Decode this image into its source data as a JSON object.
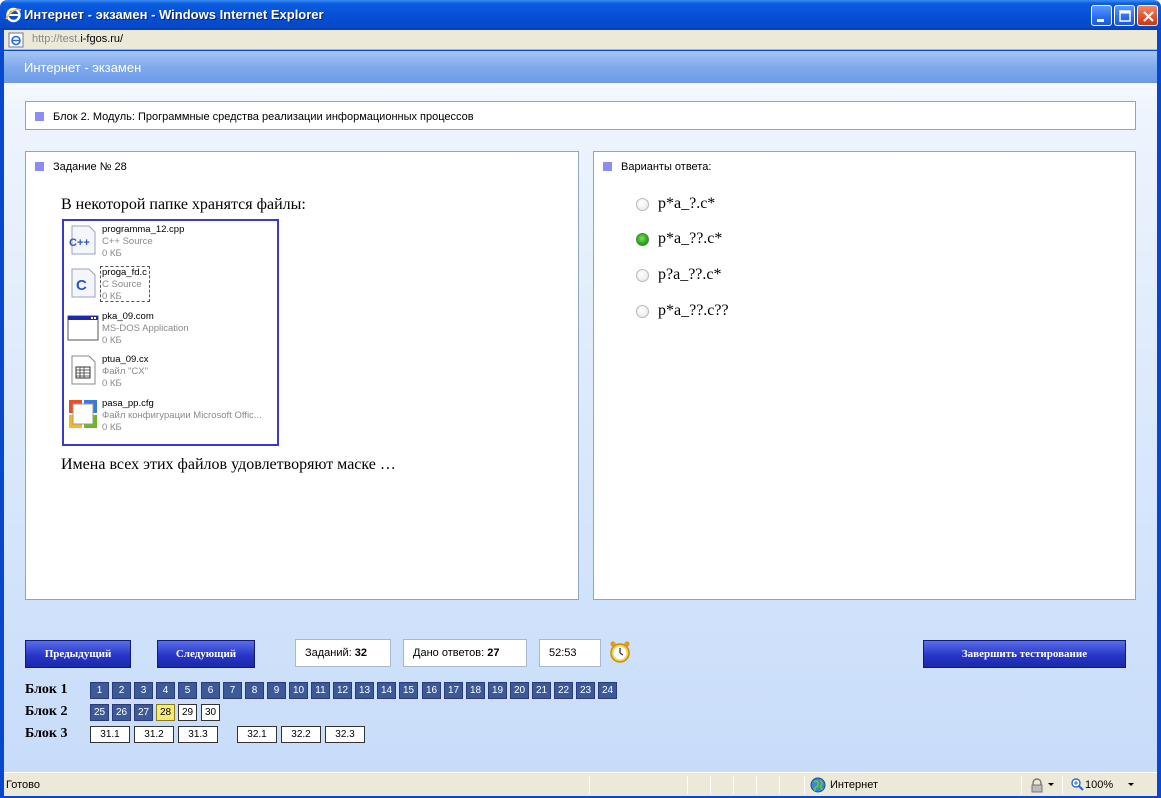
{
  "window": {
    "title": "Интернет - экзамен - Windows Internet Explorer",
    "address_prefix": "http://test.",
    "address_host": "i-fgos.ru/"
  },
  "app": {
    "header_title": "Интернет - экзамен",
    "block_heading": "Блок 2. Модуль: Программные средства реализации информационных процессов"
  },
  "task": {
    "heading": "Задание № 28",
    "text_intro": "В некоторой папке хранятся файлы:",
    "text_question": "Имена всех этих файлов удовлетворяют маске …",
    "files": [
      {
        "name": "programma_12.cpp",
        "type": "C++ Source",
        "size": "0 КБ",
        "icon": "cpp-file-icon"
      },
      {
        "name": "proga_fd.c",
        "type": "C Source",
        "size": "0 КБ",
        "icon": "c-file-icon"
      },
      {
        "name": "pka_09.com",
        "type": "MS-DOS Application",
        "size": "0 КБ",
        "icon": "dos-app-icon"
      },
      {
        "name": "ptua_09.cx",
        "type": "Файл \"CX\"",
        "size": "0 КБ",
        "icon": "generic-file-icon"
      },
      {
        "name": "pasa_pp.cfg",
        "type": "Файл конфигурации Microsoft Offic...",
        "size": "0 КБ",
        "icon": "office-config-icon"
      }
    ]
  },
  "answers": {
    "heading": "Варианты ответа:",
    "options": [
      {
        "label": "p*a_?.c*",
        "selected": false
      },
      {
        "label": "p*a_??.c*",
        "selected": true
      },
      {
        "label": "p?a_??.c*",
        "selected": false
      },
      {
        "label": "p*a_??.c??",
        "selected": false
      }
    ]
  },
  "controls": {
    "prev_label": "Предыдущий",
    "next_label": "Следующий",
    "finish_label": "Завершить тестирование",
    "tasks_label": "Заданий:",
    "tasks_value": "32",
    "answered_label": "Дано ответов:",
    "answered_value": "27",
    "timer": "52:53"
  },
  "blocks": [
    {
      "label": "Блок 1",
      "items": [
        "1",
        "2",
        "3",
        "4",
        "5",
        "6",
        "7",
        "8",
        "9",
        "10",
        "11",
        "12",
        "13",
        "14",
        "15",
        "16",
        "17",
        "18",
        "19",
        "20",
        "21",
        "22",
        "23",
        "24"
      ],
      "states": [
        "answered",
        "answered",
        "answered",
        "answered",
        "answered",
        "answered",
        "answered",
        "answered",
        "answered",
        "answered",
        "answered",
        "answered",
        "answered",
        "answered",
        "answered",
        "answered",
        "answered",
        "answered",
        "answered",
        "answered",
        "answered",
        "answered",
        "answered",
        "answered"
      ]
    },
    {
      "label": "Блок 2",
      "items": [
        "25",
        "26",
        "27",
        "28",
        "29",
        "30"
      ],
      "states": [
        "answered",
        "answered",
        "answered",
        "current",
        "empty",
        "empty"
      ]
    },
    {
      "label": "Блок 3",
      "items": [
        "31.1",
        "31.2",
        "31.3",
        "32.1",
        "32.2",
        "32.3"
      ],
      "states": [
        "empty",
        "empty",
        "empty",
        "empty",
        "empty",
        "empty"
      ]
    }
  ],
  "statusbar": {
    "status": "Готово",
    "zone": "Интернет",
    "zoom": "100%"
  },
  "colors": {
    "accent_square": "#8b8ef0",
    "answered_cell": "#3d5a98",
    "current_cell": "#f7ec7a",
    "button": "#2736c9",
    "radio_checked": "#2aa51a"
  }
}
